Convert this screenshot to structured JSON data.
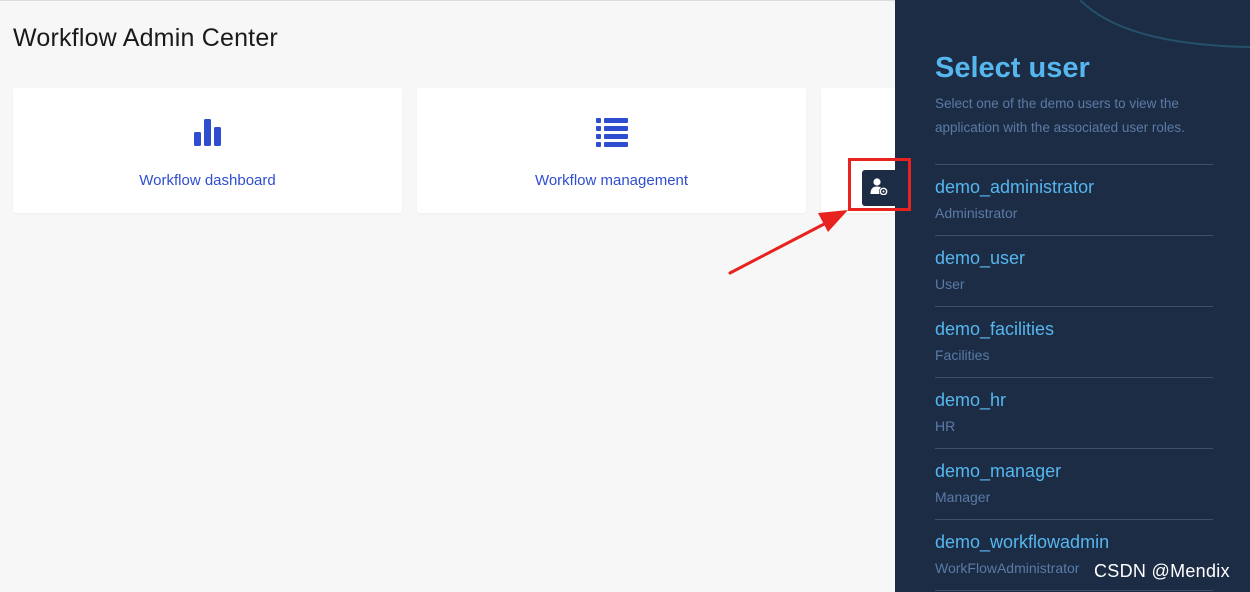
{
  "page": {
    "title": "Workflow Admin Center"
  },
  "cards": [
    {
      "label": "Workflow dashboard",
      "icon": "bar-chart-icon"
    },
    {
      "label": "Workflow management",
      "icon": "list-icon"
    },
    {
      "label": "",
      "icon": ""
    }
  ],
  "user_switch": {
    "icon": "user-switch-icon"
  },
  "panel": {
    "title": "Select user",
    "description": "Select one of the demo users to view the application with the associated user roles.",
    "users": [
      {
        "name": "demo_administrator",
        "role": "Administrator"
      },
      {
        "name": "demo_user",
        "role": "User"
      },
      {
        "name": "demo_facilities",
        "role": "Facilities"
      },
      {
        "name": "demo_hr",
        "role": "HR"
      },
      {
        "name": "demo_manager",
        "role": "Manager"
      },
      {
        "name": "demo_workflowadmin",
        "role": "WorkFlowAdministrator"
      }
    ]
  },
  "watermark": "CSDN @Mendix",
  "colors": {
    "accent_blue": "#2f4ecf",
    "panel_background": "#1c2c45",
    "panel_title": "#56b6ee",
    "panel_muted": "#5a7ba6",
    "annotation_red": "#e8231f"
  }
}
